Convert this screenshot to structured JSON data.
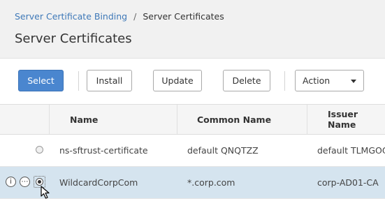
{
  "breadcrumb": {
    "parent": "Server Certificate Binding",
    "separator": "/",
    "current": "Server Certificates"
  },
  "page": {
    "title": "Server Certificates"
  },
  "toolbar": {
    "select": "Select",
    "install": "Install",
    "update": "Update",
    "delete": "Delete",
    "action": "Action"
  },
  "table": {
    "columns": [
      "Name",
      "Common Name",
      "Issuer Name"
    ],
    "rows": [
      {
        "name": "ns-sftrust-certificate",
        "common_name": "default QNQTZZ",
        "issuer": "default TLMGOQ",
        "selected": false
      },
      {
        "name": "WildcardCorpCom",
        "common_name": "*.corp.com",
        "issuer": "corp-AD01-CA",
        "selected": true
      }
    ]
  },
  "icons": {
    "info": "info-icon",
    "more": "more-options-icon",
    "caret": "chevron-down-icon",
    "cursor": "mouse-pointer-icon"
  },
  "colors": {
    "primary_button": "#4a86cf",
    "breadcrumb_link": "#3f79b8",
    "selected_row": "#d5e4ef"
  }
}
